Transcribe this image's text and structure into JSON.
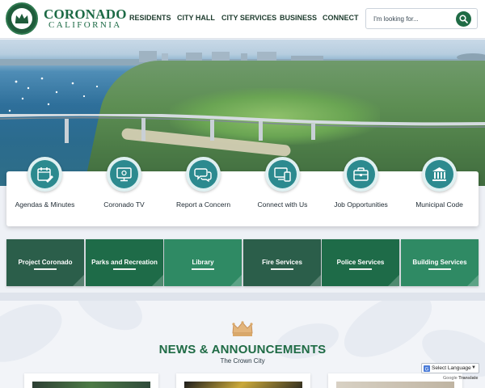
{
  "site": {
    "logo_seal_text": "CITY OF CORONADO",
    "title": "CORONADO",
    "subtitle": "CALIFORNIA"
  },
  "nav": {
    "items": [
      {
        "label": "RESIDENTS"
      },
      {
        "label": "CITY HALL"
      },
      {
        "label": "CITY SERVICES"
      },
      {
        "label": "BUSINESS"
      },
      {
        "label": "CONNECT"
      }
    ]
  },
  "search": {
    "placeholder": "I'm looking for..."
  },
  "quick_links": [
    {
      "label": "Agendas & Minutes",
      "icon": "calendar-edit-icon"
    },
    {
      "label": "Coronado TV",
      "icon": "monitor-icon"
    },
    {
      "label": "Report a Concern",
      "icon": "chat-bubbles-icon"
    },
    {
      "label": "Connect with Us",
      "icon": "devices-icon"
    },
    {
      "label": "Job Opportunities",
      "icon": "briefcase-icon"
    },
    {
      "label": "Municipal Code",
      "icon": "courthouse-icon"
    }
  ],
  "tiles": [
    {
      "label": "Project Coronado",
      "color": "#2b5e4a"
    },
    {
      "label": "Parks and Recreation",
      "color": "#1e6b48"
    },
    {
      "label": "Library",
      "color": "#2f8a64"
    },
    {
      "label": "Fire Services",
      "color": "#2b5e4a"
    },
    {
      "label": "Police Services",
      "color": "#1e6b48"
    },
    {
      "label": "Building Services",
      "color": "#2f8a64"
    }
  ],
  "news": {
    "title": "NEWS & ANNOUNCEMENTS",
    "subtitle": "The Crown City",
    "icon": "crown-icon"
  },
  "translate": {
    "label": "Select Language",
    "powered_prefix": "Google",
    "powered_label": "Translate"
  },
  "colors": {
    "brand_green": "#1c6a45",
    "quick_icon_teal": "#2c8a8f",
    "crown_gold": "#d9a86a"
  }
}
